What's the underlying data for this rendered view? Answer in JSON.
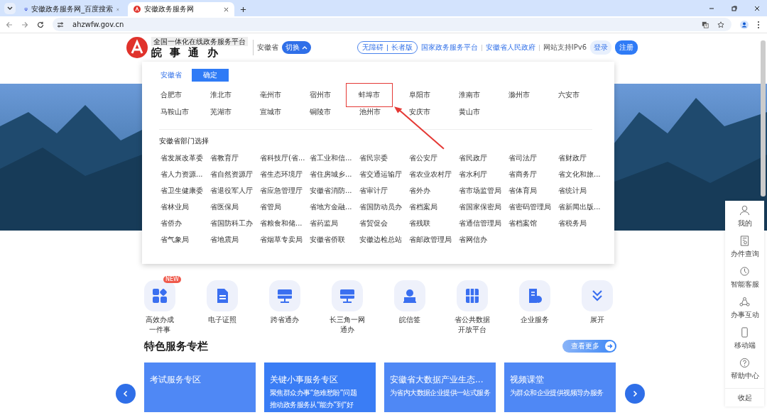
{
  "browser": {
    "tabs": [
      {
        "title": "安徽政务服务网_百度搜索",
        "selected": false
      },
      {
        "title": "安徽政务服务网",
        "selected": true
      }
    ],
    "url": "ahzwfw.gov.cn"
  },
  "header": {
    "slogan": "全国一体化在线政务服务平台",
    "brand": "皖 事 通 办",
    "region": "安徽省",
    "switch_label": "切换",
    "modes": [
      "无障碍",
      "长者版"
    ],
    "links": [
      "国家政务服务平台",
      "安徽省人民政府"
    ],
    "ipv6_note": "网站支持IPv6",
    "login": "登录",
    "register": "注册"
  },
  "region_picker": {
    "current": "安徽省",
    "confirm": "确定",
    "cities": [
      {
        "name": "合肥市",
        "highlighted": false
      },
      {
        "name": "淮北市",
        "highlighted": false
      },
      {
        "name": "亳州市",
        "highlighted": false
      },
      {
        "name": "宿州市",
        "highlighted": false
      },
      {
        "name": "蚌埠市",
        "highlighted": true
      },
      {
        "name": "阜阳市",
        "highlighted": false
      },
      {
        "name": "淮南市",
        "highlighted": false
      },
      {
        "name": "滁州市",
        "highlighted": false
      },
      {
        "name": "六安市",
        "highlighted": false
      },
      {
        "name": "马鞍山市",
        "highlighted": false
      },
      {
        "name": "芜湖市",
        "highlighted": false
      },
      {
        "name": "宣城市",
        "highlighted": false
      },
      {
        "name": "铜陵市",
        "highlighted": false
      },
      {
        "name": "池州市",
        "highlighted": false
      },
      {
        "name": "安庆市",
        "highlighted": false
      },
      {
        "name": "黄山市",
        "highlighted": false
      }
    ],
    "departments_title": "安徽省部门选择",
    "departments": [
      "省发展改革委",
      "省教育厅",
      "省科技厅(省...",
      "省工业和信...",
      "省民宗委",
      "省公安厅",
      "省民政厅",
      "省司法厅",
      "省财政厅",
      "省人力资源...",
      "省自然资源厅",
      "省生态环境厅",
      "省住房城乡...",
      "省交通运输厅",
      "省农业农村厅",
      "省水利厅",
      "省商务厅",
      "省文化和旅...",
      "省卫生健康委",
      "省退役军人厅",
      "省应急管理厅",
      "安徽省消防...",
      "省审计厅",
      "省外办",
      "省市场监管局",
      "省体育局",
      "省统计局",
      "省林业局",
      "省医保局",
      "省管局",
      "省地方金融...",
      "省国防动员办",
      "省档案局",
      "省国家保密局",
      "省密码管理局",
      "省新闻出版...",
      "省侨办",
      "省国防科工办",
      "省粮食和储...",
      "省药监局",
      "省贸促会",
      "省残联",
      "省通信管理局",
      "省档案馆",
      "省税务局",
      "省气象局",
      "省地震局",
      "省烟草专卖局",
      "安徽省侨联",
      "安徽边检总站",
      "省邮政管理局",
      "省网信办"
    ]
  },
  "sidebar": {
    "items": [
      "我的",
      "办件查询",
      "智能客服",
      "办事互动",
      "移动端",
      "帮助中心"
    ],
    "collapse": "收起"
  },
  "services": [
    {
      "lines": [
        "高效办成",
        "一件事"
      ],
      "badge": "NEW"
    },
    {
      "lines": [
        "电子证照"
      ]
    },
    {
      "lines": [
        "跨省通办"
      ]
    },
    {
      "lines": [
        "长三角一网",
        "通办"
      ]
    },
    {
      "lines": [
        "皖信签"
      ]
    },
    {
      "lines": [
        "省公共数据",
        "开放平台"
      ]
    },
    {
      "lines": [
        "企业服务"
      ]
    },
    {
      "lines": [
        "展开"
      ]
    }
  ],
  "featured": {
    "title": "特色服务专栏",
    "more": "查看更多",
    "cards": [
      {
        "title": "考试服务专区"
      },
      {
        "title": "关键小事服务专区",
        "lines": [
          "聚焦群众办事“急难愁盼”问题",
          "推动政务服务从“能办”到“好"
        ]
      },
      {
        "title": "安徽省大数据产业生态...",
        "lines": [
          "为省内大数据企业提供一站式服务"
        ]
      },
      {
        "title": "视频课堂",
        "lines": [
          "为群众和企业提供视频导办服务"
        ]
      }
    ]
  }
}
